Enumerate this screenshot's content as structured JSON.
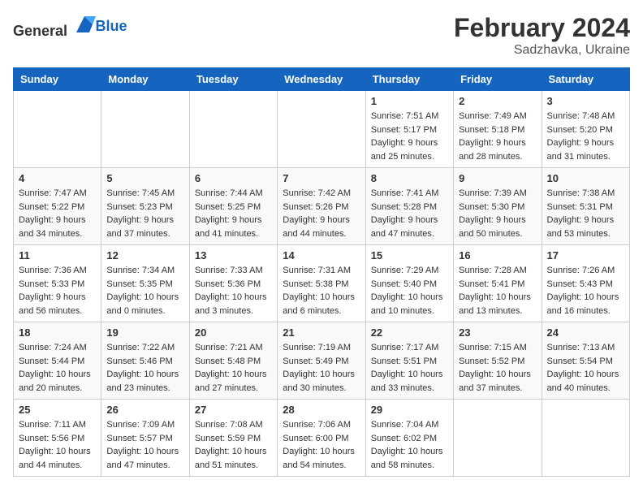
{
  "header": {
    "logo_general": "General",
    "logo_blue": "Blue",
    "month_year": "February 2024",
    "location": "Sadzhavka, Ukraine"
  },
  "days_of_week": [
    "Sunday",
    "Monday",
    "Tuesday",
    "Wednesday",
    "Thursday",
    "Friday",
    "Saturday"
  ],
  "weeks": [
    [
      {
        "day": "",
        "sunrise": "",
        "sunset": "",
        "daylight": ""
      },
      {
        "day": "",
        "sunrise": "",
        "sunset": "",
        "daylight": ""
      },
      {
        "day": "",
        "sunrise": "",
        "sunset": "",
        "daylight": ""
      },
      {
        "day": "",
        "sunrise": "",
        "sunset": "",
        "daylight": ""
      },
      {
        "day": "1",
        "sunrise": "Sunrise: 7:51 AM",
        "sunset": "Sunset: 5:17 PM",
        "daylight": "Daylight: 9 hours and 25 minutes."
      },
      {
        "day": "2",
        "sunrise": "Sunrise: 7:49 AM",
        "sunset": "Sunset: 5:18 PM",
        "daylight": "Daylight: 9 hours and 28 minutes."
      },
      {
        "day": "3",
        "sunrise": "Sunrise: 7:48 AM",
        "sunset": "Sunset: 5:20 PM",
        "daylight": "Daylight: 9 hours and 31 minutes."
      }
    ],
    [
      {
        "day": "4",
        "sunrise": "Sunrise: 7:47 AM",
        "sunset": "Sunset: 5:22 PM",
        "daylight": "Daylight: 9 hours and 34 minutes."
      },
      {
        "day": "5",
        "sunrise": "Sunrise: 7:45 AM",
        "sunset": "Sunset: 5:23 PM",
        "daylight": "Daylight: 9 hours and 37 minutes."
      },
      {
        "day": "6",
        "sunrise": "Sunrise: 7:44 AM",
        "sunset": "Sunset: 5:25 PM",
        "daylight": "Daylight: 9 hours and 41 minutes."
      },
      {
        "day": "7",
        "sunrise": "Sunrise: 7:42 AM",
        "sunset": "Sunset: 5:26 PM",
        "daylight": "Daylight: 9 hours and 44 minutes."
      },
      {
        "day": "8",
        "sunrise": "Sunrise: 7:41 AM",
        "sunset": "Sunset: 5:28 PM",
        "daylight": "Daylight: 9 hours and 47 minutes."
      },
      {
        "day": "9",
        "sunrise": "Sunrise: 7:39 AM",
        "sunset": "Sunset: 5:30 PM",
        "daylight": "Daylight: 9 hours and 50 minutes."
      },
      {
        "day": "10",
        "sunrise": "Sunrise: 7:38 AM",
        "sunset": "Sunset: 5:31 PM",
        "daylight": "Daylight: 9 hours and 53 minutes."
      }
    ],
    [
      {
        "day": "11",
        "sunrise": "Sunrise: 7:36 AM",
        "sunset": "Sunset: 5:33 PM",
        "daylight": "Daylight: 9 hours and 56 minutes."
      },
      {
        "day": "12",
        "sunrise": "Sunrise: 7:34 AM",
        "sunset": "Sunset: 5:35 PM",
        "daylight": "Daylight: 10 hours and 0 minutes."
      },
      {
        "day": "13",
        "sunrise": "Sunrise: 7:33 AM",
        "sunset": "Sunset: 5:36 PM",
        "daylight": "Daylight: 10 hours and 3 minutes."
      },
      {
        "day": "14",
        "sunrise": "Sunrise: 7:31 AM",
        "sunset": "Sunset: 5:38 PM",
        "daylight": "Daylight: 10 hours and 6 minutes."
      },
      {
        "day": "15",
        "sunrise": "Sunrise: 7:29 AM",
        "sunset": "Sunset: 5:40 PM",
        "daylight": "Daylight: 10 hours and 10 minutes."
      },
      {
        "day": "16",
        "sunrise": "Sunrise: 7:28 AM",
        "sunset": "Sunset: 5:41 PM",
        "daylight": "Daylight: 10 hours and 13 minutes."
      },
      {
        "day": "17",
        "sunrise": "Sunrise: 7:26 AM",
        "sunset": "Sunset: 5:43 PM",
        "daylight": "Daylight: 10 hours and 16 minutes."
      }
    ],
    [
      {
        "day": "18",
        "sunrise": "Sunrise: 7:24 AM",
        "sunset": "Sunset: 5:44 PM",
        "daylight": "Daylight: 10 hours and 20 minutes."
      },
      {
        "day": "19",
        "sunrise": "Sunrise: 7:22 AM",
        "sunset": "Sunset: 5:46 PM",
        "daylight": "Daylight: 10 hours and 23 minutes."
      },
      {
        "day": "20",
        "sunrise": "Sunrise: 7:21 AM",
        "sunset": "Sunset: 5:48 PM",
        "daylight": "Daylight: 10 hours and 27 minutes."
      },
      {
        "day": "21",
        "sunrise": "Sunrise: 7:19 AM",
        "sunset": "Sunset: 5:49 PM",
        "daylight": "Daylight: 10 hours and 30 minutes."
      },
      {
        "day": "22",
        "sunrise": "Sunrise: 7:17 AM",
        "sunset": "Sunset: 5:51 PM",
        "daylight": "Daylight: 10 hours and 33 minutes."
      },
      {
        "day": "23",
        "sunrise": "Sunrise: 7:15 AM",
        "sunset": "Sunset: 5:52 PM",
        "daylight": "Daylight: 10 hours and 37 minutes."
      },
      {
        "day": "24",
        "sunrise": "Sunrise: 7:13 AM",
        "sunset": "Sunset: 5:54 PM",
        "daylight": "Daylight: 10 hours and 40 minutes."
      }
    ],
    [
      {
        "day": "25",
        "sunrise": "Sunrise: 7:11 AM",
        "sunset": "Sunset: 5:56 PM",
        "daylight": "Daylight: 10 hours and 44 minutes."
      },
      {
        "day": "26",
        "sunrise": "Sunrise: 7:09 AM",
        "sunset": "Sunset: 5:57 PM",
        "daylight": "Daylight: 10 hours and 47 minutes."
      },
      {
        "day": "27",
        "sunrise": "Sunrise: 7:08 AM",
        "sunset": "Sunset: 5:59 PM",
        "daylight": "Daylight: 10 hours and 51 minutes."
      },
      {
        "day": "28",
        "sunrise": "Sunrise: 7:06 AM",
        "sunset": "Sunset: 6:00 PM",
        "daylight": "Daylight: 10 hours and 54 minutes."
      },
      {
        "day": "29",
        "sunrise": "Sunrise: 7:04 AM",
        "sunset": "Sunset: 6:02 PM",
        "daylight": "Daylight: 10 hours and 58 minutes."
      },
      {
        "day": "",
        "sunrise": "",
        "sunset": "",
        "daylight": ""
      },
      {
        "day": "",
        "sunrise": "",
        "sunset": "",
        "daylight": ""
      }
    ]
  ]
}
